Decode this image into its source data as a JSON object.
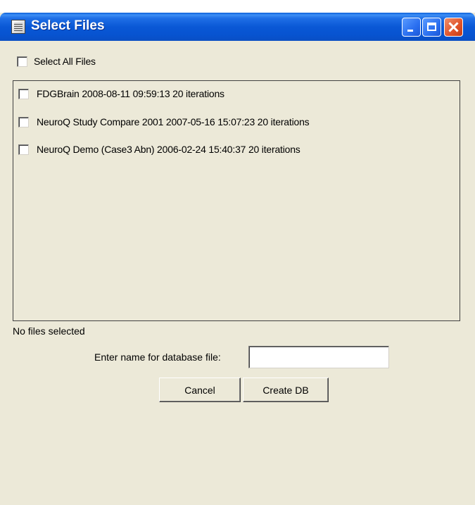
{
  "window": {
    "title": "Select Files"
  },
  "select_all": {
    "label": "Select All Files",
    "checked": false
  },
  "files": [
    {
      "label": "FDGBrain 2008-08-11 09:59:13 20 iterations",
      "checked": false
    },
    {
      "label": "NeuroQ Study Compare 2001 2007-05-16 15:07:23 20 iterations",
      "checked": false
    },
    {
      "label": "NeuroQ Demo (Case3 Abn) 2006-02-24 15:40:37 20 iterations",
      "checked": false
    }
  ],
  "status": {
    "text": "No files selected"
  },
  "db_name": {
    "label": "Enter name for database file:",
    "value": "",
    "placeholder": ""
  },
  "buttons": {
    "cancel": "Cancel",
    "create": "Create DB"
  },
  "colors": {
    "titlebar": "#0a58d6",
    "window_bg": "#ece9d8",
    "close_button": "#e0532a"
  }
}
